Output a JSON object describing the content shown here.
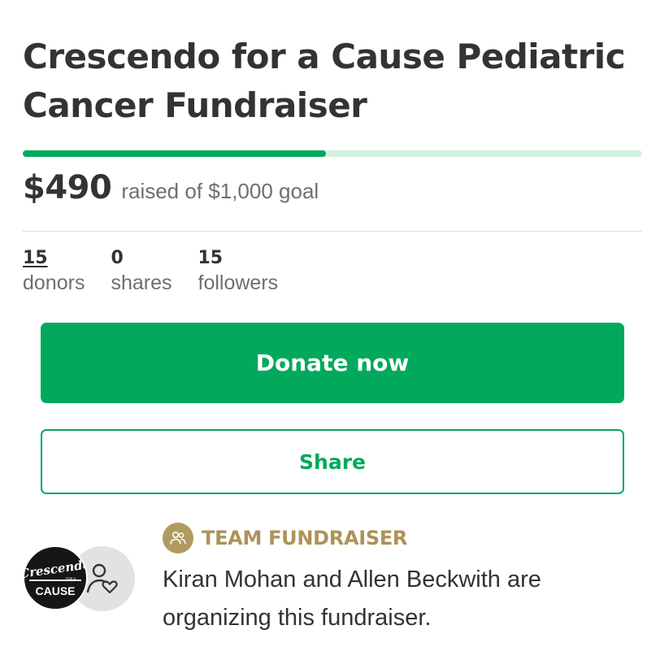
{
  "campaign": {
    "title": "Crescendo for a Cause Pediatric Cancer Fundraiser",
    "raised_amount": "$490",
    "raised_caption": "raised of $1,000 goal",
    "progress_fraction": 0.49
  },
  "stats": {
    "donors": {
      "value": "15",
      "label": "donors"
    },
    "shares": {
      "value": "0",
      "label": "shares"
    },
    "followers": {
      "value": "15",
      "label": "followers"
    }
  },
  "actions": {
    "donate_label": "Donate now",
    "share_label": "Share"
  },
  "organizer": {
    "badge_label": "TEAM FUNDRAISER",
    "description": "Kiran Mohan and Allen Beckwith are organizing this fundraiser.",
    "logo_text": {
      "main": "Crescendo",
      "small": "FOR A",
      "bottom": "CAUSE"
    }
  },
  "colors": {
    "brand_green": "#02a95c",
    "progress_track": "#d2f3e0",
    "badge_gold": "#ad925a",
    "text_dark": "#333333",
    "text_muted": "#6f6f6f"
  },
  "icons": {
    "team": "team-people-icon",
    "organizer": "person-heart-icon"
  }
}
